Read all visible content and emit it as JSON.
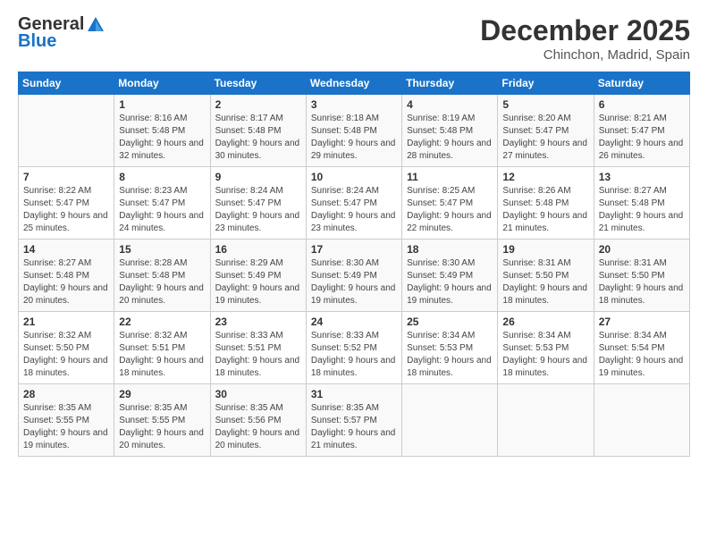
{
  "header": {
    "logo_line1": "General",
    "logo_line2": "Blue",
    "month": "December 2025",
    "location": "Chinchon, Madrid, Spain"
  },
  "days_of_week": [
    "Sunday",
    "Monday",
    "Tuesday",
    "Wednesday",
    "Thursday",
    "Friday",
    "Saturday"
  ],
  "weeks": [
    [
      {
        "day": "",
        "sunrise": "",
        "sunset": "",
        "daylight": ""
      },
      {
        "day": "1",
        "sunrise": "Sunrise: 8:16 AM",
        "sunset": "Sunset: 5:48 PM",
        "daylight": "Daylight: 9 hours and 32 minutes."
      },
      {
        "day": "2",
        "sunrise": "Sunrise: 8:17 AM",
        "sunset": "Sunset: 5:48 PM",
        "daylight": "Daylight: 9 hours and 30 minutes."
      },
      {
        "day": "3",
        "sunrise": "Sunrise: 8:18 AM",
        "sunset": "Sunset: 5:48 PM",
        "daylight": "Daylight: 9 hours and 29 minutes."
      },
      {
        "day": "4",
        "sunrise": "Sunrise: 8:19 AM",
        "sunset": "Sunset: 5:48 PM",
        "daylight": "Daylight: 9 hours and 28 minutes."
      },
      {
        "day": "5",
        "sunrise": "Sunrise: 8:20 AM",
        "sunset": "Sunset: 5:47 PM",
        "daylight": "Daylight: 9 hours and 27 minutes."
      },
      {
        "day": "6",
        "sunrise": "Sunrise: 8:21 AM",
        "sunset": "Sunset: 5:47 PM",
        "daylight": "Daylight: 9 hours and 26 minutes."
      }
    ],
    [
      {
        "day": "7",
        "sunrise": "Sunrise: 8:22 AM",
        "sunset": "Sunset: 5:47 PM",
        "daylight": "Daylight: 9 hours and 25 minutes."
      },
      {
        "day": "8",
        "sunrise": "Sunrise: 8:23 AM",
        "sunset": "Sunset: 5:47 PM",
        "daylight": "Daylight: 9 hours and 24 minutes."
      },
      {
        "day": "9",
        "sunrise": "Sunrise: 8:24 AM",
        "sunset": "Sunset: 5:47 PM",
        "daylight": "Daylight: 9 hours and 23 minutes."
      },
      {
        "day": "10",
        "sunrise": "Sunrise: 8:24 AM",
        "sunset": "Sunset: 5:47 PM",
        "daylight": "Daylight: 9 hours and 23 minutes."
      },
      {
        "day": "11",
        "sunrise": "Sunrise: 8:25 AM",
        "sunset": "Sunset: 5:47 PM",
        "daylight": "Daylight: 9 hours and 22 minutes."
      },
      {
        "day": "12",
        "sunrise": "Sunrise: 8:26 AM",
        "sunset": "Sunset: 5:48 PM",
        "daylight": "Daylight: 9 hours and 21 minutes."
      },
      {
        "day": "13",
        "sunrise": "Sunrise: 8:27 AM",
        "sunset": "Sunset: 5:48 PM",
        "daylight": "Daylight: 9 hours and 21 minutes."
      }
    ],
    [
      {
        "day": "14",
        "sunrise": "Sunrise: 8:27 AM",
        "sunset": "Sunset: 5:48 PM",
        "daylight": "Daylight: 9 hours and 20 minutes."
      },
      {
        "day": "15",
        "sunrise": "Sunrise: 8:28 AM",
        "sunset": "Sunset: 5:48 PM",
        "daylight": "Daylight: 9 hours and 20 minutes."
      },
      {
        "day": "16",
        "sunrise": "Sunrise: 8:29 AM",
        "sunset": "Sunset: 5:49 PM",
        "daylight": "Daylight: 9 hours and 19 minutes."
      },
      {
        "day": "17",
        "sunrise": "Sunrise: 8:30 AM",
        "sunset": "Sunset: 5:49 PM",
        "daylight": "Daylight: 9 hours and 19 minutes."
      },
      {
        "day": "18",
        "sunrise": "Sunrise: 8:30 AM",
        "sunset": "Sunset: 5:49 PM",
        "daylight": "Daylight: 9 hours and 19 minutes."
      },
      {
        "day": "19",
        "sunrise": "Sunrise: 8:31 AM",
        "sunset": "Sunset: 5:50 PM",
        "daylight": "Daylight: 9 hours and 18 minutes."
      },
      {
        "day": "20",
        "sunrise": "Sunrise: 8:31 AM",
        "sunset": "Sunset: 5:50 PM",
        "daylight": "Daylight: 9 hours and 18 minutes."
      }
    ],
    [
      {
        "day": "21",
        "sunrise": "Sunrise: 8:32 AM",
        "sunset": "Sunset: 5:50 PM",
        "daylight": "Daylight: 9 hours and 18 minutes."
      },
      {
        "day": "22",
        "sunrise": "Sunrise: 8:32 AM",
        "sunset": "Sunset: 5:51 PM",
        "daylight": "Daylight: 9 hours and 18 minutes."
      },
      {
        "day": "23",
        "sunrise": "Sunrise: 8:33 AM",
        "sunset": "Sunset: 5:51 PM",
        "daylight": "Daylight: 9 hours and 18 minutes."
      },
      {
        "day": "24",
        "sunrise": "Sunrise: 8:33 AM",
        "sunset": "Sunset: 5:52 PM",
        "daylight": "Daylight: 9 hours and 18 minutes."
      },
      {
        "day": "25",
        "sunrise": "Sunrise: 8:34 AM",
        "sunset": "Sunset: 5:53 PM",
        "daylight": "Daylight: 9 hours and 18 minutes."
      },
      {
        "day": "26",
        "sunrise": "Sunrise: 8:34 AM",
        "sunset": "Sunset: 5:53 PM",
        "daylight": "Daylight: 9 hours and 18 minutes."
      },
      {
        "day": "27",
        "sunrise": "Sunrise: 8:34 AM",
        "sunset": "Sunset: 5:54 PM",
        "daylight": "Daylight: 9 hours and 19 minutes."
      }
    ],
    [
      {
        "day": "28",
        "sunrise": "Sunrise: 8:35 AM",
        "sunset": "Sunset: 5:55 PM",
        "daylight": "Daylight: 9 hours and 19 minutes."
      },
      {
        "day": "29",
        "sunrise": "Sunrise: 8:35 AM",
        "sunset": "Sunset: 5:55 PM",
        "daylight": "Daylight: 9 hours and 20 minutes."
      },
      {
        "day": "30",
        "sunrise": "Sunrise: 8:35 AM",
        "sunset": "Sunset: 5:56 PM",
        "daylight": "Daylight: 9 hours and 20 minutes."
      },
      {
        "day": "31",
        "sunrise": "Sunrise: 8:35 AM",
        "sunset": "Sunset: 5:57 PM",
        "daylight": "Daylight: 9 hours and 21 minutes."
      },
      {
        "day": "",
        "sunrise": "",
        "sunset": "",
        "daylight": ""
      },
      {
        "day": "",
        "sunrise": "",
        "sunset": "",
        "daylight": ""
      },
      {
        "day": "",
        "sunrise": "",
        "sunset": "",
        "daylight": ""
      }
    ]
  ]
}
